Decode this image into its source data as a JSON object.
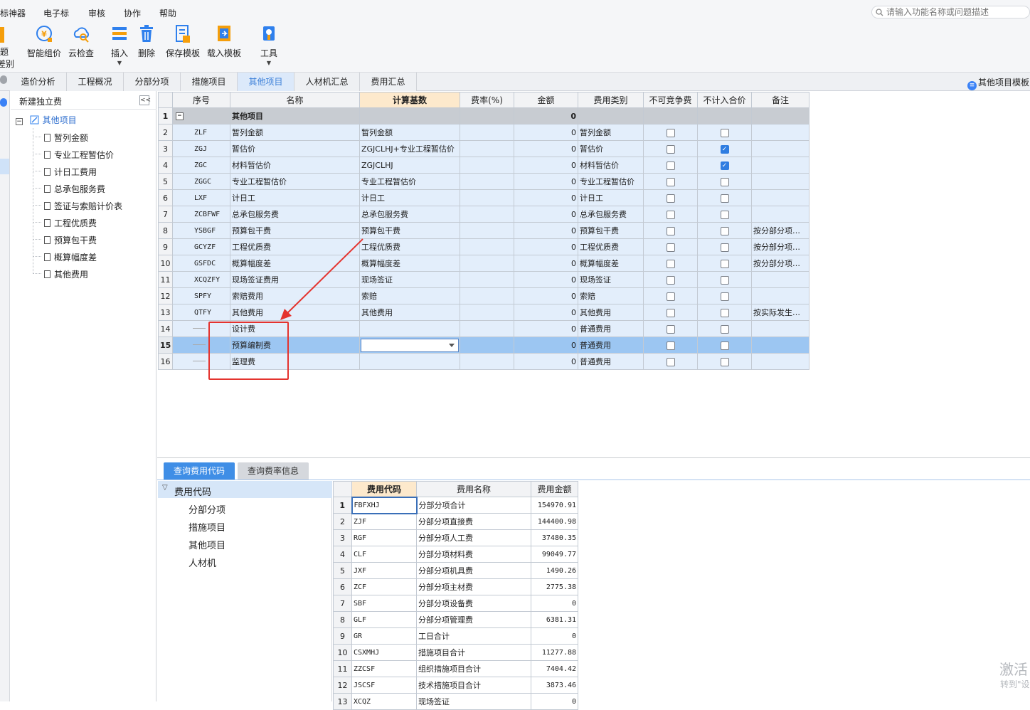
{
  "menu": {
    "items": [
      "标神器",
      "电子标",
      "审核",
      "协作",
      "帮助"
    ]
  },
  "search": {
    "placeholder": "请输入功能名称或问题描述"
  },
  "ribbon": {
    "left_partial_top": "题",
    "left_partial_bottom": "差别",
    "buttons": [
      {
        "label": "智能组价",
        "icon": "smart-price-icon"
      },
      {
        "label": "云检查",
        "icon": "cloud-check-icon"
      },
      {
        "label": "插入",
        "icon": "insert-icon"
      },
      {
        "label": "删除",
        "icon": "delete-icon"
      },
      {
        "label": "保存模板",
        "icon": "save-template-icon"
      },
      {
        "label": "载入模板",
        "icon": "load-template-icon"
      },
      {
        "label": "工具",
        "icon": "tools-icon"
      }
    ]
  },
  "tabs": {
    "items": [
      "造价分析",
      "工程概况",
      "分部分项",
      "措施项目",
      "其他项目",
      "人材机汇总",
      "费用汇总"
    ],
    "active": "其他项目",
    "right_label": "其他项目模板"
  },
  "tree": {
    "header": "新建独立费",
    "root": "其他项目",
    "children": [
      "暂列金额",
      "专业工程暂估价",
      "计日工费用",
      "总承包服务费",
      "签证与索赔计价表",
      "工程优质费",
      "预算包干费",
      "概算幅度差",
      "其他费用"
    ]
  },
  "main_grid": {
    "columns": [
      "序号",
      "名称",
      "计算基数",
      "费率(%)",
      "金额",
      "费用类别",
      "不可竞争费",
      "不计入合价",
      "备注"
    ],
    "rows": [
      {
        "no": "1",
        "code": "",
        "name": "其他项目",
        "base": "",
        "rate": "",
        "amount": "0",
        "category": "",
        "nc": false,
        "nj": false,
        "note": "",
        "type": "group"
      },
      {
        "no": "2",
        "code": "ZLF",
        "name": "暂列金额",
        "base": "暂列金额",
        "rate": "",
        "amount": "0",
        "category": "暂列金额",
        "nc": false,
        "nj": false,
        "note": ""
      },
      {
        "no": "3",
        "code": "ZGJ",
        "name": "暂估价",
        "base": "ZGJCLHJ+专业工程暂估价",
        "rate": "",
        "amount": "0",
        "category": "暂估价",
        "nc": false,
        "nj": true,
        "note": ""
      },
      {
        "no": "4",
        "code": "ZGC",
        "name": "材料暂估价",
        "base": "ZGJCLHJ",
        "rate": "",
        "amount": "0",
        "category": "材料暂估价",
        "nc": false,
        "nj": true,
        "note": ""
      },
      {
        "no": "5",
        "code": "ZGGC",
        "name": "专业工程暂估价",
        "base": "专业工程暂估价",
        "rate": "",
        "amount": "0",
        "category": "专业工程暂估价",
        "nc": false,
        "nj": false,
        "note": ""
      },
      {
        "no": "6",
        "code": "LXF",
        "name": "计日工",
        "base": "计日工",
        "rate": "",
        "amount": "0",
        "category": "计日工",
        "nc": false,
        "nj": false,
        "note": ""
      },
      {
        "no": "7",
        "code": "ZCBFWF",
        "name": "总承包服务费",
        "base": "总承包服务费",
        "rate": "",
        "amount": "0",
        "category": "总承包服务费",
        "nc": false,
        "nj": false,
        "note": ""
      },
      {
        "no": "8",
        "code": "YSBGF",
        "name": "预算包干费",
        "base": "预算包干费",
        "rate": "",
        "amount": "0",
        "category": "预算包干费",
        "nc": false,
        "nj": false,
        "note": "按分部分项…"
      },
      {
        "no": "9",
        "code": "GCYZF",
        "name": "工程优质费",
        "base": "工程优质费",
        "rate": "",
        "amount": "0",
        "category": "工程优质费",
        "nc": false,
        "nj": false,
        "note": "按分部分项…"
      },
      {
        "no": "10",
        "code": "GSFDC",
        "name": "概算幅度差",
        "base": "概算幅度差",
        "rate": "",
        "amount": "0",
        "category": "概算幅度差",
        "nc": false,
        "nj": false,
        "note": "按分部分项…"
      },
      {
        "no": "11",
        "code": "XCQZFY",
        "name": "现场签证费用",
        "base": "现场签证",
        "rate": "",
        "amount": "0",
        "category": "现场签证",
        "nc": false,
        "nj": false,
        "note": ""
      },
      {
        "no": "12",
        "code": "SPFY",
        "name": "索赔费用",
        "base": "索赔",
        "rate": "",
        "amount": "0",
        "category": "索赔",
        "nc": false,
        "nj": false,
        "note": ""
      },
      {
        "no": "13",
        "code": "QTFY",
        "name": "其他费用",
        "base": "其他费用",
        "rate": "",
        "amount": "0",
        "category": "其他费用",
        "nc": false,
        "nj": false,
        "note": "按实际发生…"
      },
      {
        "no": "14",
        "code": "",
        "name": "设计费",
        "base": "",
        "rate": "",
        "amount": "0",
        "category": "普通费用",
        "nc": false,
        "nj": false,
        "note": ""
      },
      {
        "no": "15",
        "code": "",
        "name": "预算编制费",
        "base": "",
        "rate": "",
        "amount": "0",
        "category": "普通费用",
        "nc": false,
        "nj": false,
        "note": "",
        "type": "selected"
      },
      {
        "no": "16",
        "code": "",
        "name": "监理费",
        "base": "",
        "rate": "",
        "amount": "0",
        "category": "普通费用",
        "nc": false,
        "nj": false,
        "note": ""
      }
    ]
  },
  "bottom": {
    "tabs": [
      "查询费用代码",
      "查询费率信息"
    ],
    "active_tab": "查询费用代码",
    "code_tree": {
      "root": "费用代码",
      "items": [
        "分部分项",
        "措施项目",
        "其他项目",
        "人材机"
      ]
    },
    "code_grid": {
      "columns": [
        "费用代码",
        "费用名称",
        "费用金额"
      ],
      "rows": [
        {
          "no": "1",
          "code": "FBFXHJ",
          "name": "分部分项合计",
          "amount": "154970.91"
        },
        {
          "no": "2",
          "code": "ZJF",
          "name": "分部分项直接费",
          "amount": "144400.98"
        },
        {
          "no": "3",
          "code": "RGF",
          "name": "分部分项人工费",
          "amount": "37480.35"
        },
        {
          "no": "4",
          "code": "CLF",
          "name": "分部分项材料费",
          "amount": "99049.77"
        },
        {
          "no": "5",
          "code": "JXF",
          "name": "分部分项机具费",
          "amount": "1490.26"
        },
        {
          "no": "6",
          "code": "ZCF",
          "name": "分部分项主材费",
          "amount": "2775.38"
        },
        {
          "no": "7",
          "code": "SBF",
          "name": "分部分项设备费",
          "amount": "0"
        },
        {
          "no": "8",
          "code": "GLF",
          "name": "分部分项管理费",
          "amount": "6381.31"
        },
        {
          "no": "9",
          "code": "GR",
          "name": "工日合计",
          "amount": "0"
        },
        {
          "no": "10",
          "code": "CSXMHJ",
          "name": "措施项目合计",
          "amount": "11277.88"
        },
        {
          "no": "11",
          "code": "ZZCSF",
          "name": "组织措施项目合计",
          "amount": "7404.42"
        },
        {
          "no": "12",
          "code": "JSCSF",
          "name": "技术措施项目合计",
          "amount": "3873.46"
        },
        {
          "no": "13",
          "code": "XCQZ",
          "name": "现场签证",
          "amount": "0"
        }
      ]
    }
  },
  "watermark": {
    "line1": "激活",
    "line2": "转到\"设"
  },
  "colors": {
    "accent": "#3f8ee6",
    "row_bg": "#e3eefb",
    "selected_row": "#9cc6f2",
    "annotation_red": "#e4332e",
    "header_highlight": "#fde9cc"
  }
}
